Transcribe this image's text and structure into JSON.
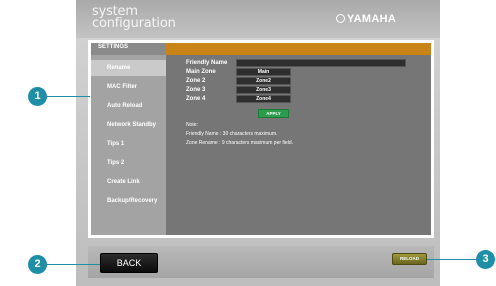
{
  "header": {
    "title_line1": "system",
    "title_line2": "configuration",
    "brand": "YAMAHA"
  },
  "settings_label": "SETTINGS",
  "sidebar": {
    "items": [
      {
        "label": "Rename",
        "active": true
      },
      {
        "label": "MAC Filter"
      },
      {
        "label": "Auto Reload"
      },
      {
        "label": "Network Standby"
      },
      {
        "label": "Tips 1"
      },
      {
        "label": "Tips 2"
      },
      {
        "label": "Create Link"
      },
      {
        "label": "Backup/Recovery"
      }
    ]
  },
  "form": {
    "friendly_name_label": "Friendly Name",
    "friendly_name_value": "",
    "zones": [
      {
        "label": "Main Zone",
        "value": "Main"
      },
      {
        "label": "Zone 2",
        "value": "Zone2"
      },
      {
        "label": "Zone 3",
        "value": "Zone3"
      },
      {
        "label": "Zone 4",
        "value": "Zone4"
      }
    ],
    "apply_label": "APPLY"
  },
  "note": {
    "heading": "Note:",
    "line1": "Friendly Name : 30 characters maximum.",
    "line2": "Zone Rename : 9 characters maximum per field."
  },
  "footer": {
    "back_label": "BACK",
    "reload_label": "RELOAD"
  },
  "callouts": [
    "1",
    "2",
    "3"
  ],
  "colors": {
    "callout": "#1e8fa7",
    "settings_bar": "#c98418",
    "apply": "#2d9d4d"
  }
}
